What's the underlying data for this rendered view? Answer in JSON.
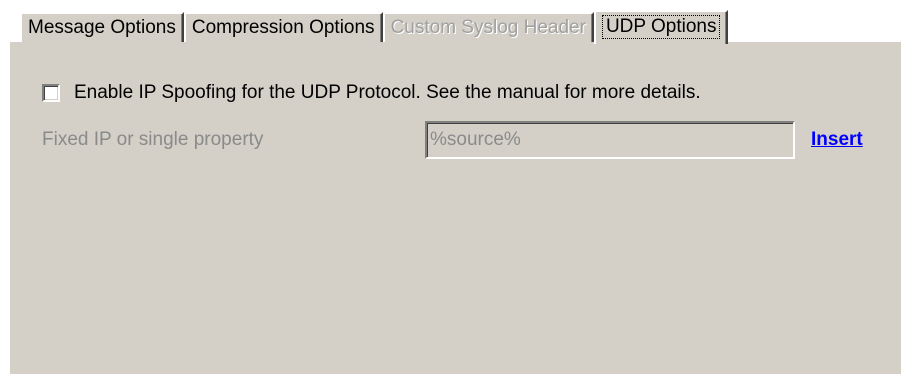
{
  "tabs": [
    {
      "label": "Message Options",
      "state": "normal"
    },
    {
      "label": "Compression Options",
      "state": "normal"
    },
    {
      "label": "Custom Syslog Header",
      "state": "disabled"
    },
    {
      "label": "UDP Options",
      "state": "active"
    }
  ],
  "udp_options": {
    "spoofing_checkbox_label": "Enable IP Spoofing for the UDP Protocol. See the manual for more details.",
    "spoofing_checked": false,
    "fixed_ip_label": "Fixed IP or single property",
    "fixed_ip_value": "%source%",
    "insert_link": "Insert"
  },
  "colors": {
    "dialog_face": "#d4d0c8",
    "disabled_text": "#8a8a8a",
    "link": "#0000ff"
  }
}
